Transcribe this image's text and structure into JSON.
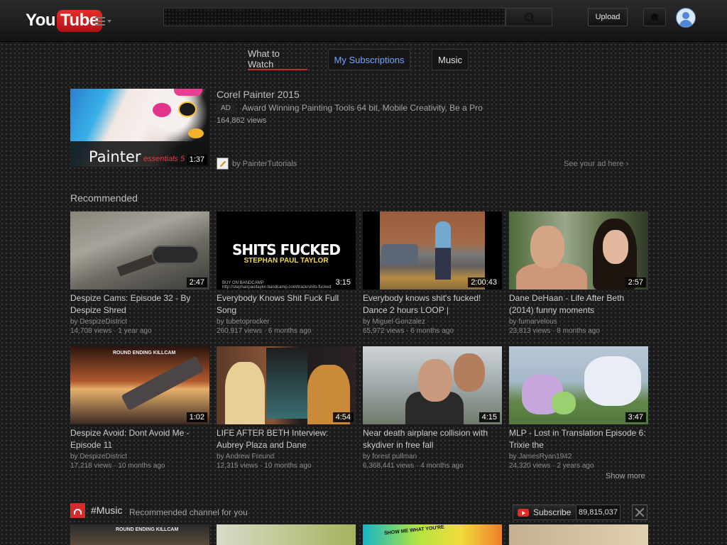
{
  "header": {
    "logo_you": "You",
    "logo_tube": "Tube",
    "search_placeholder": "",
    "upload_label": "Upload"
  },
  "tabs": [
    {
      "label": "What to Watch",
      "active": true
    },
    {
      "label": "My Subscriptions",
      "active": false
    },
    {
      "label": "Music",
      "active": false
    }
  ],
  "ad": {
    "title": "Corel Painter 2015",
    "badge": "AD",
    "description": "Award Winning Painting Tools 64 bit, Mobile Creativity, Be a Pro",
    "views": "164,862 views",
    "duration": "1:37",
    "thumb_brand": "Painter",
    "thumb_brand_sub": "essentials 5",
    "by": "by PainterTutorials",
    "see_ad_link": "See your ad here ›"
  },
  "recommended": {
    "heading": "Recommended",
    "videos": [
      {
        "title": "Despize Cams: Episode 32 - By Despize Shred",
        "by": "by DespizeDistrict",
        "views": "14,708 views",
        "age": "1 year ago",
        "duration": "2:47"
      },
      {
        "title": "Everybody Knows Shit Fuck Full Song",
        "by": "by tubetoprocker",
        "views": "260,917 views",
        "age": "6 months ago",
        "duration": "3:15",
        "thumb_text": "SHITS FUCKED",
        "thumb_subtext": "STEPHAN PAUL TAYLOR",
        "thumb_tiny": "BUY ON BANDCAMP http://stephanpaultaylor.bandcamp.com/track/shits-fucked"
      },
      {
        "title": "Everybody knows shit's fucked! Dance 2 hours LOOP |",
        "by": "by Miguel Gonzalez",
        "views": "65,972 views",
        "age": "6 months ago",
        "duration": "2:00:43"
      },
      {
        "title": "Dane DeHaan - Life After Beth (2014) funny moments",
        "by": "by fumarvelous",
        "views": "23,813 views",
        "age": "8 months ago",
        "duration": "2:57"
      },
      {
        "title": "Despize Avoid: Dont Avoid Me - Episode 11",
        "by": "by DespizeDistrict",
        "views": "17,218 views",
        "age": "10 months ago",
        "duration": "1:02",
        "thumb_text": "ROUND ENDING KILLCAM"
      },
      {
        "title": "LIFE AFTER BETH Interview: Aubrey Plaza and Dane",
        "by": "by Andrew Freund",
        "views": "12,315 views",
        "age": "10 months ago",
        "duration": "4:54"
      },
      {
        "title": "Near death airplane collision with skydiver in free fall",
        "by": "by forest pullman",
        "views": "6,368,441 views",
        "age": "4 months ago",
        "duration": "4:15"
      },
      {
        "title": "MLP - Lost in Translation Episode 6: Trixie the",
        "by": "by JamesRyan1942",
        "views": "24,320 views",
        "age": "2 years ago",
        "duration": "3:47"
      }
    ]
  },
  "show_more": "Show more",
  "music_channel": {
    "name": "#Music",
    "description": "Recommended channel for you",
    "subscribe_label": "Subscribe",
    "subscriber_count": "89,815,037",
    "preview_texts": [
      "ROUND ENDING KILLCAM",
      "SHOW ME WHAT YOU'RE"
    ]
  },
  "meta_sep": "·"
}
